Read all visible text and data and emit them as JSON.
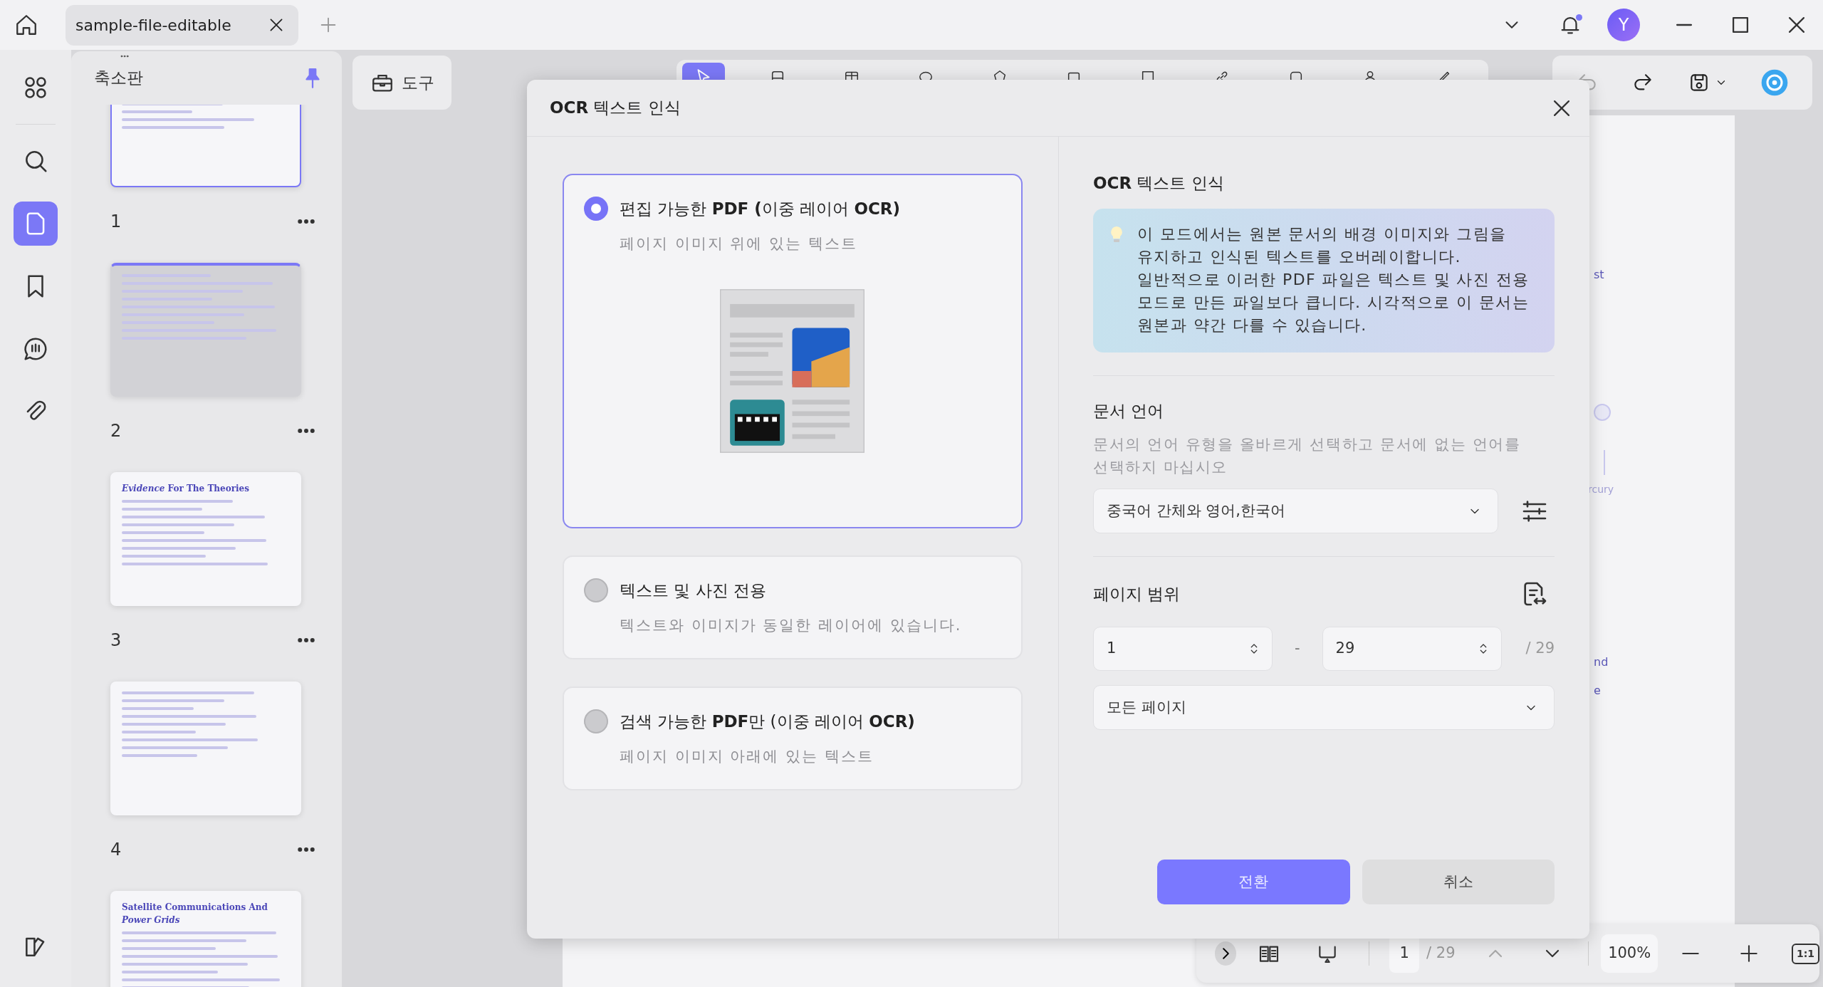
{
  "tabs": [
    {
      "label": "sample-file-editable",
      "selected": true
    }
  ],
  "window_controls": {
    "notifications_unread": true,
    "avatar_initial": "Y"
  },
  "rail": [
    {
      "kind": "grid",
      "selected": false
    },
    {
      "kind": "search",
      "selected": false
    },
    {
      "kind": "page",
      "selected": true
    },
    {
      "kind": "bookmark",
      "selected": false
    },
    {
      "kind": "comment",
      "selected": false
    },
    {
      "kind": "attachment",
      "selected": false
    }
  ],
  "thumbnails": {
    "title": "축소판",
    "pinned": true,
    "pages": [
      {
        "number": "1",
        "selected": true,
        "hovered": false
      },
      {
        "number": "2",
        "selected": false,
        "hovered": true
      },
      {
        "number": "3",
        "selected": false,
        "hovered": false,
        "title": "*Evidence* For The Theories"
      },
      {
        "number": "4",
        "selected": false,
        "hovered": false
      },
      {
        "selected": false,
        "hovered": false,
        "title": "Satellite Communications And *Power Grids*"
      }
    ]
  },
  "tools_button": "도구",
  "tools": [
    {
      "kind": "pointer",
      "selected": true
    },
    {
      "kind": "image",
      "selected": false
    },
    {
      "kind": "table",
      "selected": false
    },
    {
      "kind": "ellipse",
      "selected": false
    },
    {
      "kind": "polygon",
      "selected": false
    },
    {
      "kind": "rect",
      "selected": false
    },
    {
      "kind": "crop",
      "selected": false
    },
    {
      "kind": "link",
      "selected": false
    },
    {
      "kind": "note",
      "selected": false
    },
    {
      "kind": "person",
      "selected": false
    },
    {
      "kind": "pen",
      "selected": false
    }
  ],
  "history": {
    "undo_disabled": true,
    "redo_disabled": false
  },
  "document_fragments": [
    "st",
    "rcury",
    "nd",
    "e"
  ],
  "dialog": {
    "title": "**OCR** 텍스트 인식",
    "options": [
      {
        "title": "편집 가능한 **PDF (**이중 레이어 **OCR)**",
        "description": "페이지 이미지 위에 있는 텍스트",
        "selected": true
      },
      {
        "title": "텍스트 및 사진 전용",
        "description": "텍스트와 이미지가 동일한 레이어에 있습니다.",
        "selected": false
      },
      {
        "title": "검색 가능한 **PDF**만 (이중 레이어 **OCR)**",
        "description": "페이지 이미지 아래에 있는 텍스트",
        "selected": false
      }
    ],
    "section_title": "**OCR** 텍스트 인식",
    "info": [
      "이 모드에서는 원본 문서의 배경 이미지와 그림을 유지하고 인식된 텍스트를 오버레이합니다.",
      "일반적으로 이러한 PDF 파일은 텍스트 및 사진 전용 모드로 만든 파일보다 큽니다. 시각적으로 이 문서는 원본과 약간 다를 수 있습니다."
    ],
    "language": {
      "heading": "문서 언어",
      "hint": "문서의 언어 유형을 올바르게 선택하고 문서에 없는 언어를 선택하지 마십시오",
      "value": "중국어 간체와 영어,한국어"
    },
    "page_range": {
      "heading": "페이지 범위",
      "from": "1",
      "separator": "-",
      "to": "29",
      "total": "/ 29",
      "mode": "모든 페이지"
    },
    "convert": "전환",
    "cancel": "취소"
  },
  "bottom_bar": {
    "page": "1",
    "total": "/ 29",
    "zoom": "100%",
    "actual_size": "1:1"
  }
}
